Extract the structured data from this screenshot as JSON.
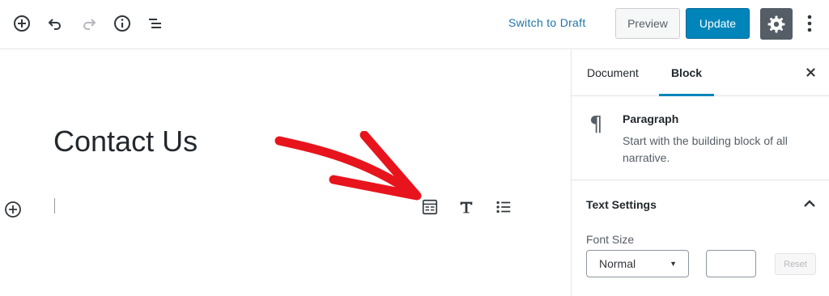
{
  "toolbar": {
    "icons": [
      "add-block-icon",
      "undo-icon",
      "redo-icon",
      "info-icon",
      "block-navigation-icon"
    ],
    "switch_to_draft": "Switch to Draft",
    "preview_label": "Preview",
    "update_label": "Update",
    "settings_icon": "gear-icon",
    "more_icon": "more-vertical-icon"
  },
  "editor": {
    "post_title": "Contact Us",
    "shortcut_icons": [
      "form-icon",
      "heading-icon",
      "list-icon"
    ]
  },
  "sidebar": {
    "tabs": [
      {
        "label": "Document",
        "active": false
      },
      {
        "label": "Block",
        "active": true
      }
    ],
    "block": {
      "icon_glyph": "¶",
      "name": "Paragraph",
      "description": "Start with the building block of all narrative."
    },
    "text_settings": {
      "title": "Text Settings",
      "font_size_label": "Font Size",
      "font_size_value": "Normal",
      "custom_size_value": "",
      "reset_label": "Reset"
    }
  },
  "colors": {
    "accent": "#0085ba",
    "link": "#1f74a8",
    "arrow": "#e8141d",
    "settings_bg": "#555d66"
  }
}
